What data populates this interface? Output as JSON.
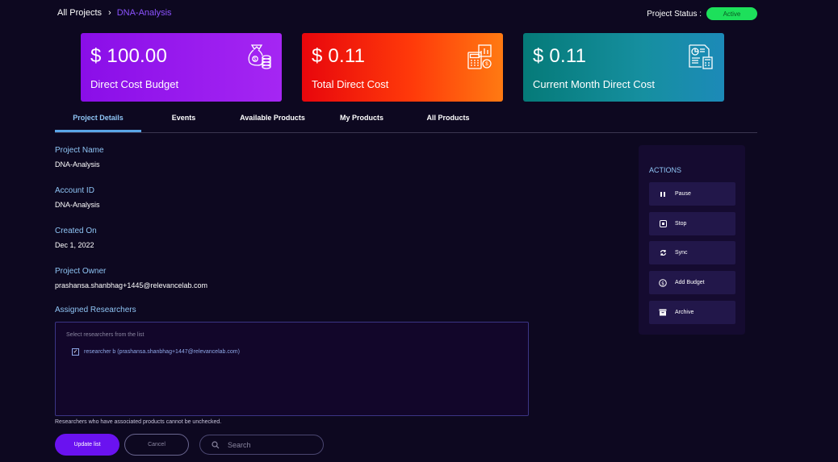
{
  "breadcrumb": {
    "home": "All Projects",
    "separator": "›",
    "current": "DNA-Analysis"
  },
  "status": {
    "label": "Project Status :",
    "value": "Active",
    "color": "#1de05b"
  },
  "cards": [
    {
      "amount": "$ 100.00",
      "label": "Direct Cost Budget",
      "icon": "money-bag-icon"
    },
    {
      "amount": "$ 0.11",
      "label": "Total Direct Cost",
      "icon": "calculator-cash-icon"
    },
    {
      "amount": "$ 0.11",
      "label": "Current Month Direct Cost",
      "icon": "report-calculator-icon"
    }
  ],
  "tabs": [
    "Project Details",
    "Events",
    "Available Products",
    "My Products",
    "All Products"
  ],
  "details": {
    "project_name_label": "Project Name",
    "project_name": "DNA-Analysis",
    "account_id_label": "Account ID",
    "account_id": "DNA-Analysis",
    "created_on_label": "Created On",
    "created_on": "Dec 1, 2022",
    "owner_label": "Project Owner",
    "owner": "prashansa.shanbhag+1445@relevancelab.com",
    "researchers_label": "Assigned Researchers"
  },
  "researchers": {
    "hint": "Select researchers from the list",
    "items": [
      {
        "label": "researcher b (prashansa.shanbhag+1447@relevancelab.com)",
        "checked": true
      }
    ],
    "note": "Researchers who have associated products cannot be unchecked."
  },
  "buttons": {
    "update": "Update list",
    "cancel": "Cancel"
  },
  "search": {
    "placeholder": "Search"
  },
  "actions": {
    "title": "ACTIONS",
    "items": [
      {
        "label": "Pause",
        "icon": "pause-icon"
      },
      {
        "label": "Stop",
        "icon": "stop-icon"
      },
      {
        "label": "Sync",
        "icon": "sync-icon"
      },
      {
        "label": "Add Budget",
        "icon": "dollar-coin-icon"
      },
      {
        "label": "Archive",
        "icon": "archive-icon"
      }
    ]
  }
}
